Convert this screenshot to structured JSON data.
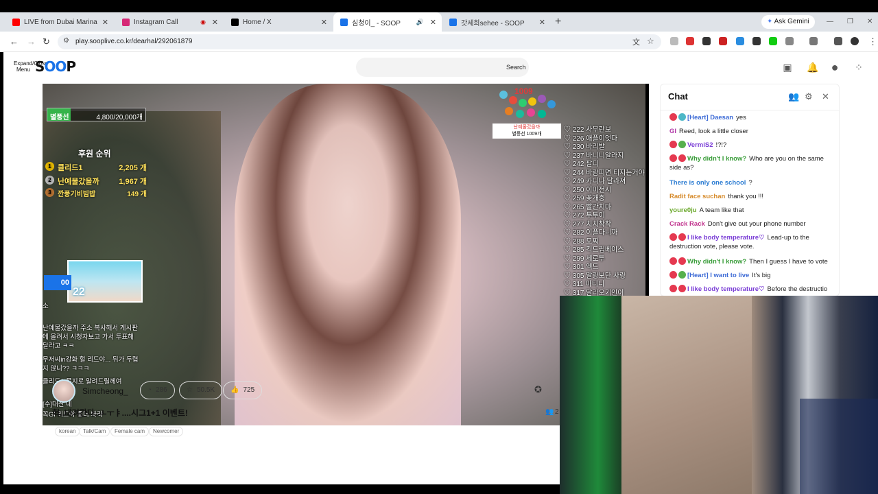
{
  "browser": {
    "tabs": [
      {
        "title": "LIVE from Dubai Marina – Tens",
        "favicon_color": "#ff0000",
        "active": false
      },
      {
        "title": "Instagram Call",
        "favicon_color": "#d62976",
        "active": false
      },
      {
        "title": "Home / X",
        "favicon_color": "#000000",
        "active": false
      },
      {
        "title": "심청이_ - SOOP",
        "favicon_color": "#1a73e8",
        "active": true
      },
      {
        "title": "갓세희sehee - SOOP",
        "favicon_color": "#1a73e8",
        "active": false
      }
    ],
    "new_tab": "+",
    "ask_gemini": "Ask Gemini",
    "url": "play.sooplive.co.kr/dearhal/292061879"
  },
  "header": {
    "menu_label_1": "Expand/Close",
    "menu_label_2": "Menu",
    "logo_s": "S",
    "logo_oo": "OO",
    "logo_p": "P",
    "search_label": "Search"
  },
  "overlay": {
    "goal_name": "별풍선",
    "goal_value": "4,800/20,000개",
    "goal_progress": 0.24,
    "ranking_title": "후원 순위",
    "ranking": [
      {
        "rank": "1",
        "name": "클리드1",
        "amount": "2,205 개"
      },
      {
        "rank": "2",
        "name": "난예물갔을까",
        "amount": "1,967 개"
      },
      {
        "rank": "3",
        "name": "깐풍기비빔밥",
        "amount": "149 개"
      }
    ],
    "thumb_badge": "00",
    "thumb_number": "22",
    "chat_lines": [
      "소",
      "난예물갔을까  주소 복사해서 게시판에 올려서 시청자보고 가서 투표해달라고 ㅋㅋ",
      "무저씨in강화  헐 리드야... 뒤가 두렵지 않니?? ㅋㅋㅋ",
      "클리드1  목지로 알려드릴께여",
      "[수]대산  네",
      "꼭GI  리드야 좀더 봐라"
    ],
    "balloon_count": "1009",
    "balloon_user": "난예물갔을까",
    "balloon_text": "별풍선 1009개",
    "menu": [
      "222 사무란보",
      "226 애플이엇다",
      "230 바리발",
      "237 바니니알라지",
      "242 팔디",
      "244 바람피면 티지는거야",
      "249 카디나 달라져",
      "250 이미전시",
      "259 꽃개충",
      "265 빨간치마",
      "272 투투이",
      "277 치치착착",
      "282 이플다니까",
      "288 모찌",
      "285 킥드립베이스",
      "299 세로투",
      "301 엑드",
      "305 말랑보단 사랑",
      "311 마티니",
      "317 달라오기인이"
    ]
  },
  "chat": {
    "title": "Chat",
    "messages": [
      {
        "nick": "[Heart] Daesan",
        "text": "yes",
        "nick_color": "#3d6bd6",
        "badges": [
          "#e53950",
          "#4cb7c7"
        ]
      },
      {
        "nick": "",
        "text": "Reed, look a little closer",
        "prefix": "GI",
        "nick_color": "#b23aa8",
        "badges": []
      },
      {
        "nick": "VermiS2",
        "text": "!?!?",
        "nick_color": "#7a3dd6",
        "badges": [
          "#e53950",
          "#56b04d"
        ]
      },
      {
        "nick": "Why didn't I know?",
        "text": "Who are you on the same side as?",
        "nick_color": "#3a9d3a",
        "badges": [
          "#e53950",
          "#e53950"
        ]
      },
      {
        "nick": "There is only one school",
        "text": "?",
        "nick_color": "#2a7bd2",
        "badges": []
      },
      {
        "nick": "Radit face suchan",
        "text": "thank you !!!",
        "nick_color": "#d68a2a",
        "badges": []
      },
      {
        "nick": "youre0ju",
        "text": "A team like that",
        "nick_color": "#6aa82a",
        "badges": []
      },
      {
        "nick": "Crack Rack",
        "text": "Don't give out your phone number",
        "nick_color": "#c2368f",
        "badges": []
      },
      {
        "nick": "I like body temperature♡",
        "text": "Lead-up to the destruction vote, please vote.",
        "nick_color": "#7a3dd6",
        "badges": [
          "#e53950",
          "#e53950"
        ]
      },
      {
        "nick": "Why didn't I know?",
        "text": "Then I guess I have to vote",
        "nick_color": "#3a9d3a",
        "badges": [
          "#e53950",
          "#e53950"
        ]
      },
      {
        "nick": "[Heart] I want to live",
        "text": "It's big",
        "nick_color": "#3d6bd6",
        "badges": [
          "#e53950",
          "#56b04d"
        ]
      },
      {
        "nick": "I like body temperature♡",
        "text": "Before the destructio",
        "nick_color": "#7a3dd6",
        "badges": [
          "#e53950",
          "#e53950"
        ]
      }
    ]
  },
  "stream": {
    "streamer": "Simcheong_",
    "stat1": "286",
    "stat2": "50.5K",
    "stat3": "725",
    "title": "헉..내려간다..ㅗㅜㅑ....시그1+1 이벤트!",
    "tags": [
      "korean",
      "Talk/Cam",
      "Female cam",
      "Newcomer"
    ],
    "viewers_partial": "2"
  }
}
